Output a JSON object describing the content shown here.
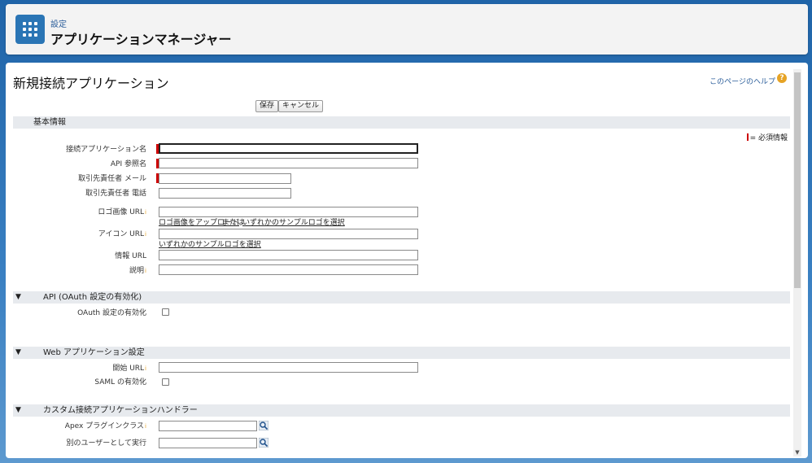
{
  "header": {
    "subtitle": "設定",
    "title": "アプリケーションマネージャー"
  },
  "page": {
    "title": "新規接続アプリケーション",
    "help_link": "このページのヘルプ",
    "help_icon": "?"
  },
  "buttons": {
    "save": "保存",
    "cancel": "キャンセル"
  },
  "sections": {
    "basic": "基本情報",
    "api": "API (OAuth 設定の有効化)",
    "web": "Web アプリケーション設定",
    "custom": "カスタム接続アプリケーションハンドラー"
  },
  "required_legend": "= 必須情報",
  "fields": {
    "connected_app_name": "接続アプリケーション名",
    "api_name": "API 参照名",
    "contact_email": "取引先責任者 メール",
    "contact_phone": "取引先責任者 電話",
    "logo_url": "ロゴ画像 URL",
    "icon_url": "アイコン URL",
    "info_url": "情報 URL",
    "description": "説明",
    "oauth_enable": "OAuth 設定の有効化",
    "start_url": "開始 URL",
    "saml_enable": "SAML の有効化",
    "apex_plugin": "Apex プラグインクラス",
    "run_as": "別のユーザーとして実行"
  },
  "links": {
    "upload_logo": "ロゴ画像をアップロード",
    "or": "または",
    "choose_sample_logo": "いずれかのサンプルロゴを選択",
    "choose_sample_logo2": "いずれかのサンプルロゴを選択"
  },
  "info_icon": "i",
  "scroll_down": "▼",
  "triangle": "▼"
}
